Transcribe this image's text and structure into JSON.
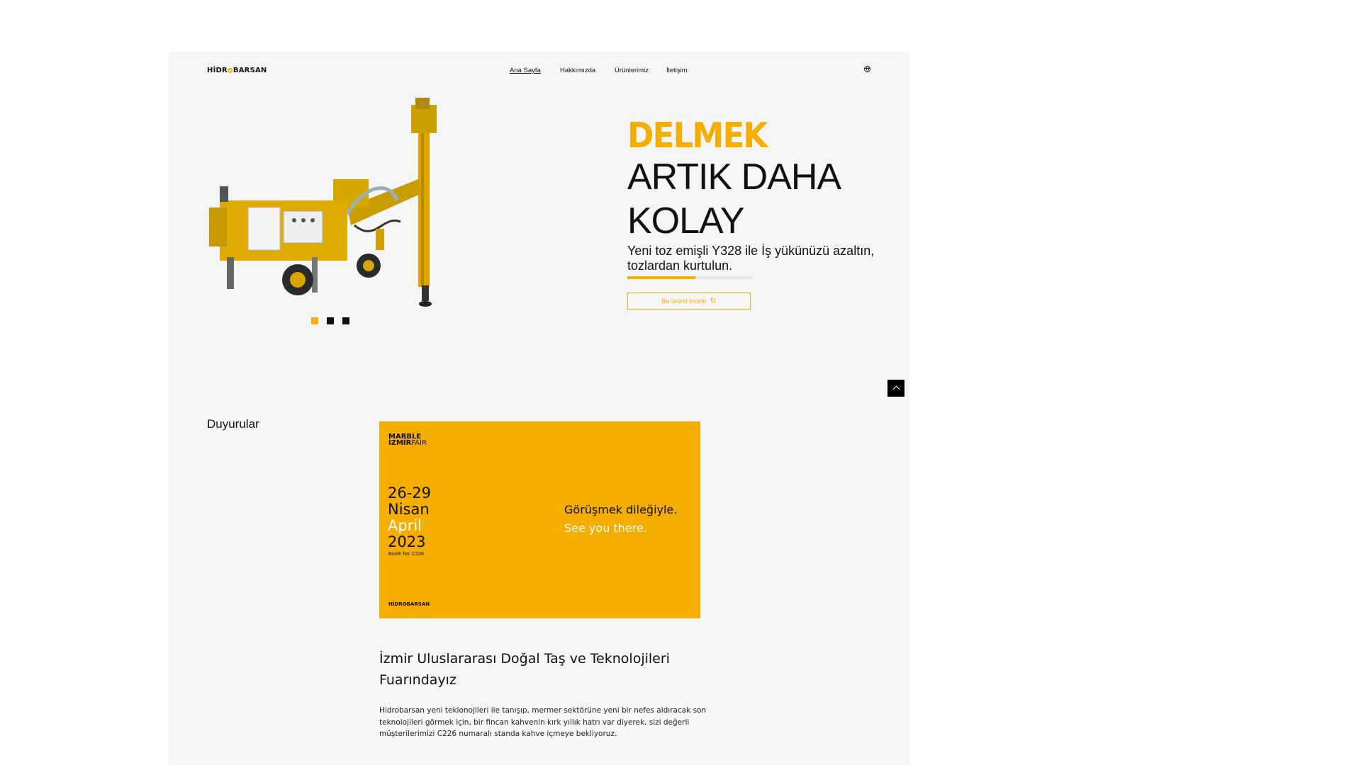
{
  "header": {
    "logo": "HİDROBARSAN",
    "nav": [
      {
        "label": "Ana Sayfa",
        "active": true
      },
      {
        "label": "Hakkımızda",
        "active": false
      },
      {
        "label": "Ürünlerimiz",
        "active": false
      },
      {
        "label": "İletişim",
        "active": false
      }
    ],
    "language_icon": "globe-icon"
  },
  "hero": {
    "headline_accent": "DELMEK",
    "headline_line2": "ARTIK DAHA",
    "headline_line3": "KOLAY",
    "subtitle": "Yeni toz emişli Y328 ile İş yükünüzü azaltın, tozlardan kurtulun.",
    "progress": 0.55,
    "cta_label": "Bu ürünü İncele",
    "cta_icon": "refresh-icon",
    "slider": {
      "count": 3,
      "active_index": 0
    },
    "image": "yellow drilling machine"
  },
  "scroll_top_icon": "chevron-up-icon",
  "announcements": {
    "title": "Duyurular",
    "card": {
      "fair_line1": "MARBLE",
      "fair_line2_bold": "İZMİR",
      "fair_line2_thin": "FAIR",
      "date_range": "26-29",
      "month_tr": "Nisan",
      "month_en": "April",
      "year": "2023",
      "booth": "Booth No: C226",
      "greeting_tr": "Görüşmek dileğiyle.",
      "greeting_en": "See you there.",
      "brand": "HİDROBARSAN"
    },
    "item_title": "İzmir Uluslararası Doğal Taş ve Teknolojileri Fuarındayız",
    "item_body": "Hidrobarsan yeni teklonojileri ile tanışıp, mermer sektörüne yeni bir nefes aldıracak son teknolojileri görmek için, bir fincan kahvenin kırk yıllık hatrı var diyerek, sizi değerli müşterilerimizi C226 numaralı standa kahve içmeye bekliyoruz."
  },
  "colors": {
    "accent": "#f5ad00",
    "page_bg": "#f5f5f5",
    "text": "#111111"
  }
}
